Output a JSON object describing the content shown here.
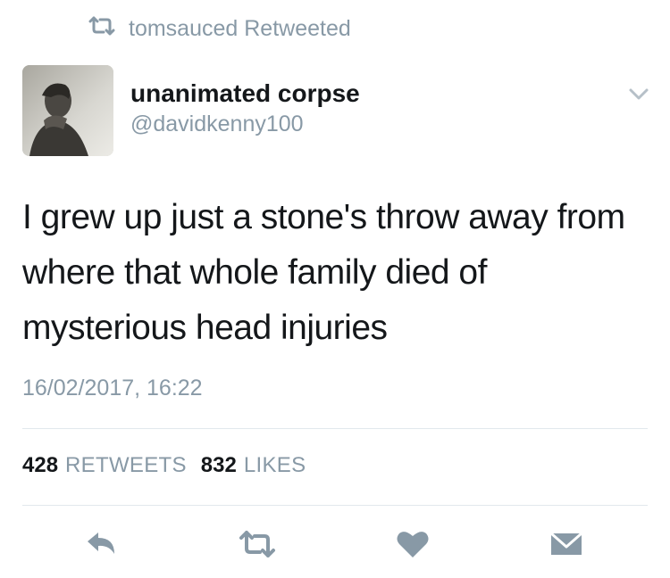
{
  "retweet_context": {
    "icon": "retweet-icon",
    "text": "tomsauced Retweeted"
  },
  "author": {
    "display_name": "unanimated corpse",
    "handle": "@davidkenny100",
    "avatar": "avatar-photo"
  },
  "tweet": {
    "text": "I grew up just a stone's throw away from where that whole family died of mysterious head injuries",
    "timestamp": "16/02/2017, 16:22"
  },
  "stats": {
    "retweets_count": "428",
    "retweets_label": "RETWEETS",
    "likes_count": "832",
    "likes_label": "LIKES"
  },
  "actions": [
    {
      "name": "reply",
      "icon": "reply-icon"
    },
    {
      "name": "retweet",
      "icon": "retweet-icon"
    },
    {
      "name": "like",
      "icon": "heart-icon"
    },
    {
      "name": "direct-message",
      "icon": "envelope-icon"
    }
  ],
  "colors": {
    "text_primary": "#14171a",
    "text_secondary": "#8899a6",
    "icon": "#8899a6",
    "divider": "#e1e8ed"
  }
}
